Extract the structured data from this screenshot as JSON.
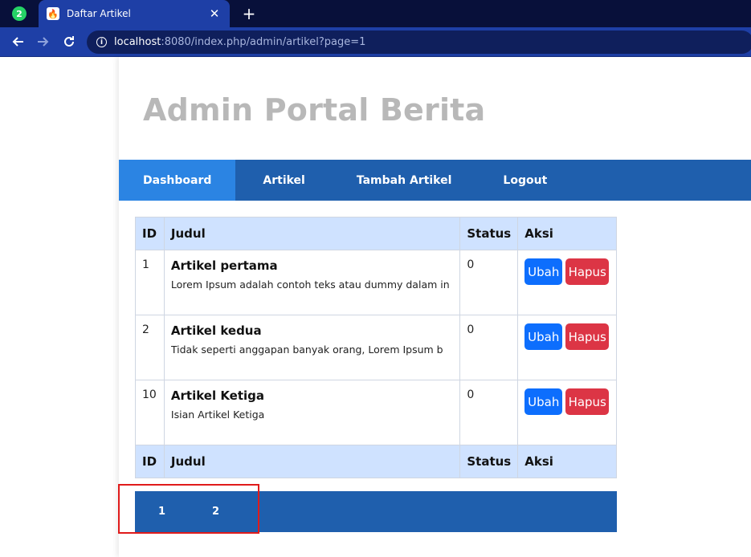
{
  "browser": {
    "tab_title": "Daftar Artikel",
    "tab_close": "✕",
    "new_tab": "+",
    "url_host": "localhost",
    "url_rest": ":8080/index.php/admin/artikel?page=1",
    "whatsapp_badge": "2"
  },
  "site": {
    "title": "Admin Portal Berita"
  },
  "nav": [
    {
      "label": "Dashboard"
    },
    {
      "label": "Artikel"
    },
    {
      "label": "Tambah Artikel"
    },
    {
      "label": "Logout"
    }
  ],
  "table": {
    "headers": [
      "ID",
      "Judul",
      "Status",
      "Aksi"
    ],
    "rows": [
      {
        "id": "1",
        "title": "Artikel pertama",
        "excerpt": "Lorem Ipsum adalah contoh teks atau dummy dalam in",
        "status": "0"
      },
      {
        "id": "2",
        "title": "Artikel kedua",
        "excerpt": "Tidak seperti anggapan banyak orang, Lorem Ipsum b",
        "status": "0"
      },
      {
        "id": "10",
        "title": "Artikel Ketiga",
        "excerpt": "Isian Artikel Ketiga",
        "status": "0"
      }
    ],
    "edit_label": "Ubah",
    "delete_label": "Hapus"
  },
  "pagination": {
    "pages": [
      "1",
      "2"
    ]
  },
  "colors": {
    "nav_bg": "#1f5fad",
    "nav_active": "#2b84e3",
    "table_header": "#cfe2ff",
    "btn_ubah": "#0d6efd",
    "btn_hapus": "#dc3545",
    "highlight": "#e01b1b"
  }
}
